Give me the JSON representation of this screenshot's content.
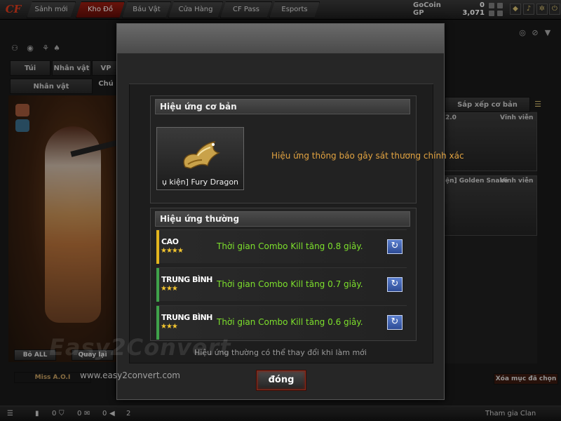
{
  "nav": {
    "logo": "CF",
    "tabs": [
      {
        "label": "Sảnh mới"
      },
      {
        "label": "Kho Đồ"
      },
      {
        "label": "Báu Vật"
      },
      {
        "label": "Cửa Hàng"
      },
      {
        "label": "CF Pass"
      },
      {
        "label": "Esports"
      }
    ],
    "active_tab": "Kho Đồ"
  },
  "currency": {
    "gocoin_label": "GoCoin",
    "gocoin_value": "0",
    "gp_label": "GP",
    "gp_value": "3,071"
  },
  "background": {
    "tabs": [
      "Túi",
      "Nhân vật",
      "VP Chú"
    ],
    "subtab": "Nhân vật",
    "sort_label": "Sắp xếp cơ bản",
    "card1_duration": "Vĩnh viễn",
    "card1_version": "2.0",
    "card2_name": "ện] Golden Snake",
    "card2_duration": "Vĩnh viễn",
    "remove_all": "Bỏ ALL",
    "rotate": "Quay lại",
    "char_name": "Miss A.O.I",
    "delete_selected": "Xóa mục đã chọn",
    "bottom_counts": [
      "0",
      "0",
      "0",
      "2"
    ],
    "join_clan": "Tham gia Clan"
  },
  "modal": {
    "basic_title": "Hiệu ứng cơ bản",
    "item_name": "ụ kiện] Fury Dragon",
    "basic_effect": "Hiệu ứng thông báo gây sát thương chính xác",
    "normal_title": "Hiệu ứng thường",
    "effects": [
      {
        "rank": "CAO",
        "stars": "★★★★",
        "text": "Thời gian Combo Kill tăng 0.8 giây.",
        "color": "#e3b51d"
      },
      {
        "rank": "TRUNG BÌNH",
        "stars": "★★★",
        "text": "Thời gian Combo Kill tăng 0.7 giây.",
        "color": "#3fa24a"
      },
      {
        "rank": "TRUNG BÌNH",
        "stars": "★★★",
        "text": "Thời gian Combo Kill tăng 0.6 giây.",
        "color": "#3fa24a"
      }
    ],
    "footnote": "Hiệu ứng thường có thể thay đổi khi làm mới",
    "close_label": "đóng"
  },
  "watermark": {
    "brand": "Easy2Convert",
    "url": "www.easy2convert.com"
  },
  "icons": [
    "reroll-icon",
    "settings-icon",
    "notification-icon",
    "friends-icon"
  ]
}
